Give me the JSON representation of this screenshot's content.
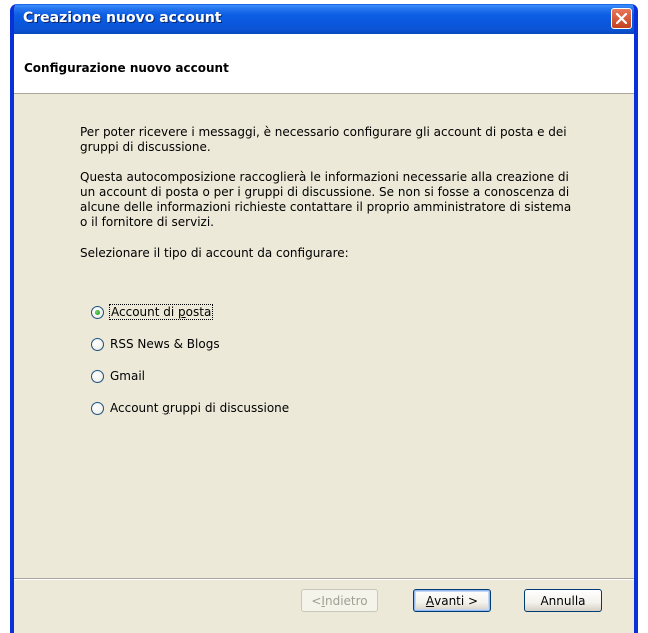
{
  "window": {
    "title": "Creazione nuovo account"
  },
  "header": {
    "title": "Configurazione nuovo account"
  },
  "content": {
    "paragraph1": "Per poter ricevere i messaggi, è necessario configurare gli account di posta e dei gruppi di discussione.",
    "paragraph2": "Questa autocomposizione raccoglierà le informazioni necessarie alla creazione di un account di posta o per i gruppi di discussione. Se non si fosse a conoscenza di alcune delle informazioni richieste contattare il proprio amministratore di sistema o il fornitore di servizi.",
    "paragraph3": "Selezionare il tipo di account da configurare:"
  },
  "options": [
    {
      "label_pre": "Account di ",
      "label_u": "p",
      "label_post": "osta",
      "selected": true
    },
    {
      "label_pre": "RSS News & Blogs",
      "label_u": "",
      "label_post": "",
      "selected": false
    },
    {
      "label_pre": "Gmail",
      "label_u": "",
      "label_post": "",
      "selected": false
    },
    {
      "label_pre": "Account ",
      "label_u": "g",
      "label_post": "ruppi di discussione",
      "selected": false
    }
  ],
  "buttons": {
    "back": {
      "pre": "< ",
      "u": "I",
      "post": "ndietro",
      "enabled": false
    },
    "next": {
      "pre": "",
      "u": "A",
      "post": "vanti >",
      "enabled": true
    },
    "cancel": {
      "label": "Annulla",
      "enabled": true
    }
  },
  "colors": {
    "titlebar": "#0a58de",
    "dialog_bg": "#ece9d8",
    "radio_selected": "#21a121",
    "close_button": "#d65b3a"
  }
}
